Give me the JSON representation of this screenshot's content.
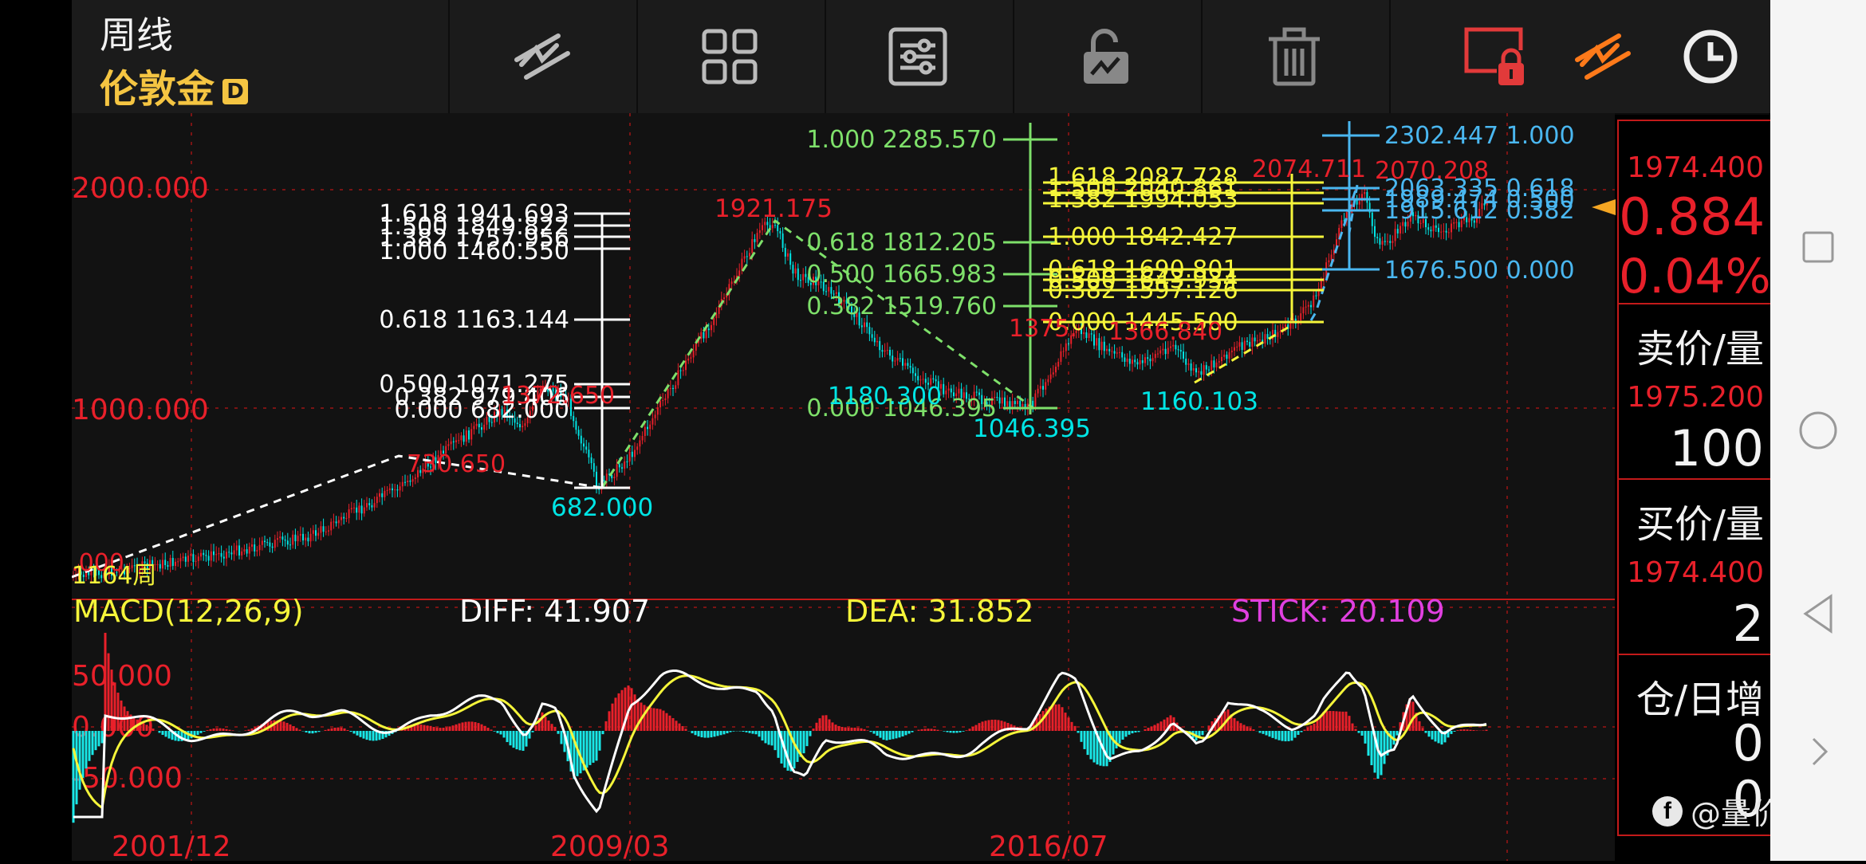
{
  "header": {
    "period": "周线",
    "symbol": "伦敦金",
    "symbol_badge": "D"
  },
  "toolbar": {
    "icons": [
      "draw-line-icon",
      "grid-layout-icon",
      "settings-sliders-icon",
      "unlock-icon",
      "trash-icon",
      "locked-screen-icon",
      "draw-tool-active-icon",
      "clock-icon"
    ]
  },
  "chart": {
    "y_labels": [
      "2000.000",
      "1000.000",
      "0.000"
    ],
    "x_labels": [
      "2001/12",
      "2009/03",
      "2016/07"
    ],
    "bars_label": "1164周",
    "price_labels": {
      "peak_2011": "1921.175",
      "low_2001_fib": "682.000",
      "low_2015": "1046.395",
      "low_2018": "1160.103",
      "peak_2020": "2074.711",
      "peak_2022": "2070.208",
      "red_1372": "1372.650",
      "red_730": "730.650",
      "cyan_1180": "1180.300",
      "red_1375": "1375.",
      "red_1366": "1366.840"
    },
    "fib_white": [
      "1.618 1941.693",
      "1.500 1849.822",
      "1.382 1757.956",
      "1.000 1460.550",
      "0.618 1163.144",
      "0.500 1071.275",
      "0.382 979.406",
      "0.000 682.000"
    ],
    "fib_green": [
      "1.000 2285.570",
      "0.618 1812.205",
      "0.500 1665.983",
      "0.382 1519.760",
      "0.000 1046.395"
    ],
    "fib_yellow": [
      "1.618 2087.728",
      "1.500 2040.861",
      "1.382 1994.053",
      "1.000 1842.427",
      "0.618 1690.801",
      "0.500 1643.934",
      "0.382 1597.126",
      "0.000 1445.500"
    ],
    "fib_blue": [
      "2302.447 1.000",
      "2063.335 0.618",
      "1989.474 0.500",
      "1915.612 0.382",
      "1676.500 0.000"
    ]
  },
  "macd": {
    "title": "MACD(12,26,9)",
    "diff": "DIFF: 41.907",
    "dea": "DEA: 31.852",
    "stick": "STICK: 20.109",
    "y_labels": [
      "50.000",
      "0.000",
      "-50.000"
    ]
  },
  "quote": {
    "last": "1974.400",
    "change": "0.884",
    "change_pct": "0.04%",
    "ask_label": "卖价/量",
    "ask_price": "1975.200",
    "ask_qty": "100",
    "bid_label": "买价/量",
    "bid_price": "1974.400",
    "bid_qty": "2",
    "oi_label": "仓/日增",
    "oi_value": "0",
    "oi_change": "0"
  },
  "watermark": "@量价王子",
  "colors": {
    "up": "#e8202a",
    "down": "#00e5e5",
    "fib_white": "#ffffff",
    "fib_green": "#7ee06a",
    "fib_yellow": "#f5f53a",
    "fib_blue": "#4ab7f0",
    "accent": "#f5c542"
  }
}
